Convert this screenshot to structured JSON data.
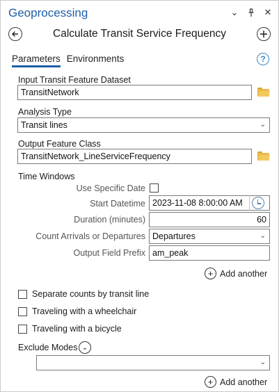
{
  "window": {
    "title": "Geoprocessing",
    "icons": [
      "chevron-down-icon",
      "pin-icon",
      "close-icon"
    ]
  },
  "tool": {
    "title": "Calculate Transit Service Frequency"
  },
  "tabs": [
    {
      "label": "Parameters",
      "active": true
    },
    {
      "label": "Environments",
      "active": false
    }
  ],
  "params": {
    "input_dataset": {
      "label": "Input Transit Feature Dataset",
      "value": "TransitNetwork"
    },
    "analysis_type": {
      "label": "Analysis Type",
      "value": "Transit lines"
    },
    "output_fc": {
      "label": "Output Feature Class",
      "value": "TransitNetwork_LineServiceFrequency"
    },
    "time_windows": {
      "label": "Time Windows",
      "use_specific_date": {
        "label": "Use Specific Date",
        "checked": false
      },
      "start_datetime": {
        "label": "Start Datetime",
        "value": "2023-11-08 8:00:00 AM"
      },
      "duration": {
        "label": "Duration (minutes)",
        "value": "60"
      },
      "count_type": {
        "label": "Count Arrivals or Departures",
        "value": "Departures"
      },
      "prefix": {
        "label": "Output Field Prefix",
        "value": "am_peak"
      },
      "add_another": "Add another"
    },
    "separate_counts": {
      "label": "Separate counts by transit line",
      "checked": false
    },
    "wheelchair": {
      "label": "Traveling with a wheelchair",
      "checked": false
    },
    "bicycle": {
      "label": "Traveling with a bicycle",
      "checked": false
    },
    "exclude_modes": {
      "label": "Exclude Modes",
      "value": "",
      "add_another": "Add another"
    }
  },
  "colors": {
    "accent": "#1f5fa8",
    "folder": "#e8b84a",
    "help": "#3c86c9"
  }
}
